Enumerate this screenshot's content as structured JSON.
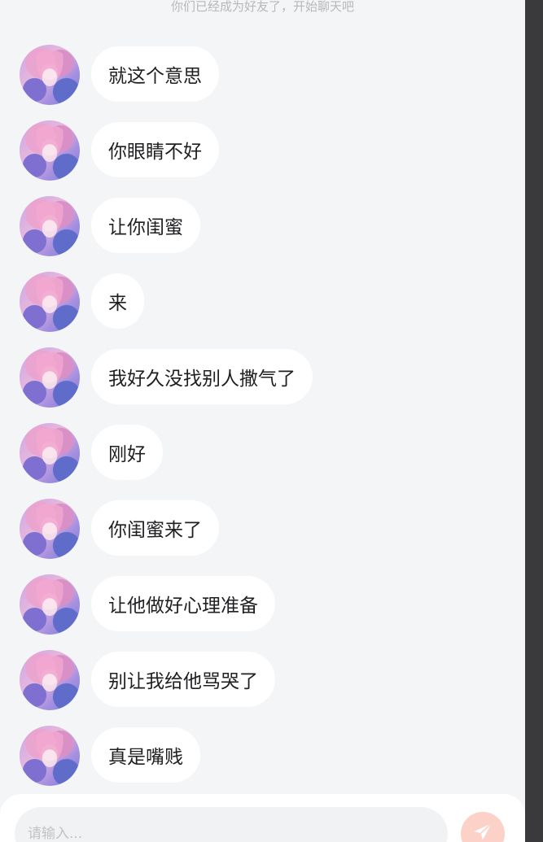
{
  "system_note": "你们已经成为好友了，开始聊天吧",
  "messages": [
    {
      "text": "就这个意思"
    },
    {
      "text": "你眼睛不好"
    },
    {
      "text": "让你闺蜜"
    },
    {
      "text": "来"
    },
    {
      "text": "我好久没找别人撒气了"
    },
    {
      "text": "刚好"
    },
    {
      "text": "你闺蜜来了"
    },
    {
      "text": "让他做好心理准备"
    },
    {
      "text": "别让我给他骂哭了"
    },
    {
      "text": "真是嘴贱"
    }
  ],
  "composer": {
    "placeholder": "请输入...",
    "send_icon": "paper-plane-icon"
  },
  "colors": {
    "background": "#f4f5f7",
    "bubble": "#ffffff",
    "send_button": "#fcd2c8"
  }
}
